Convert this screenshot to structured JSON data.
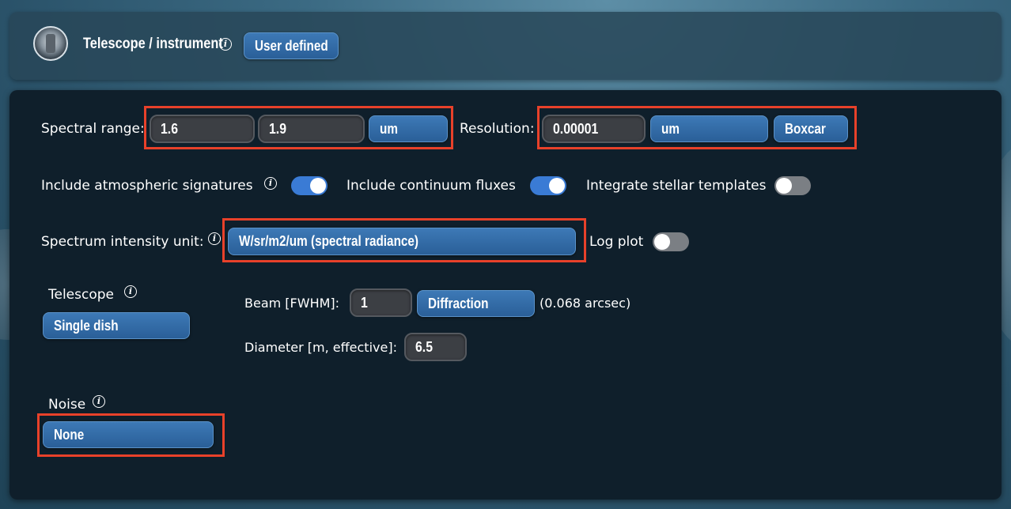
{
  "instrument": {
    "title": "Telescope / instrument",
    "mode_button": "User defined"
  },
  "spectral_range": {
    "label": "Spectral range:",
    "min": "1.6",
    "max": "1.9",
    "unit": "um"
  },
  "resolution": {
    "label": "Resolution:",
    "value": "0.00001",
    "unit": "um",
    "kernel": "Boxcar"
  },
  "toggles": {
    "atmospheric": {
      "label": "Include atmospheric signatures",
      "on": true
    },
    "continuum": {
      "label": "Include continuum fluxes",
      "on": true
    },
    "stellar": {
      "label": "Integrate stellar templates",
      "on": false
    },
    "log_plot": {
      "label": "Log plot",
      "on": false
    }
  },
  "intensity": {
    "label": "Spectrum intensity unit:",
    "value": "W/sr/m2/um (spectral radiance)"
  },
  "telescope": {
    "label": "Telescope",
    "type": "Single dish",
    "beam_label": "Beam [FWHM]:",
    "beam_value": "1",
    "beam_mode": "Diffraction",
    "beam_note": "(0.068 arcsec)",
    "diameter_label": "Diameter [m, effective]:",
    "diameter_value": "6.5"
  },
  "noise": {
    "label": "Noise",
    "value": "None"
  },
  "colors": {
    "highlight": "#e8412a",
    "button": "#2f6aa6",
    "toggle_on": "#3a7bd5",
    "panel": "#0f1f2b"
  },
  "info_glyph": "i"
}
